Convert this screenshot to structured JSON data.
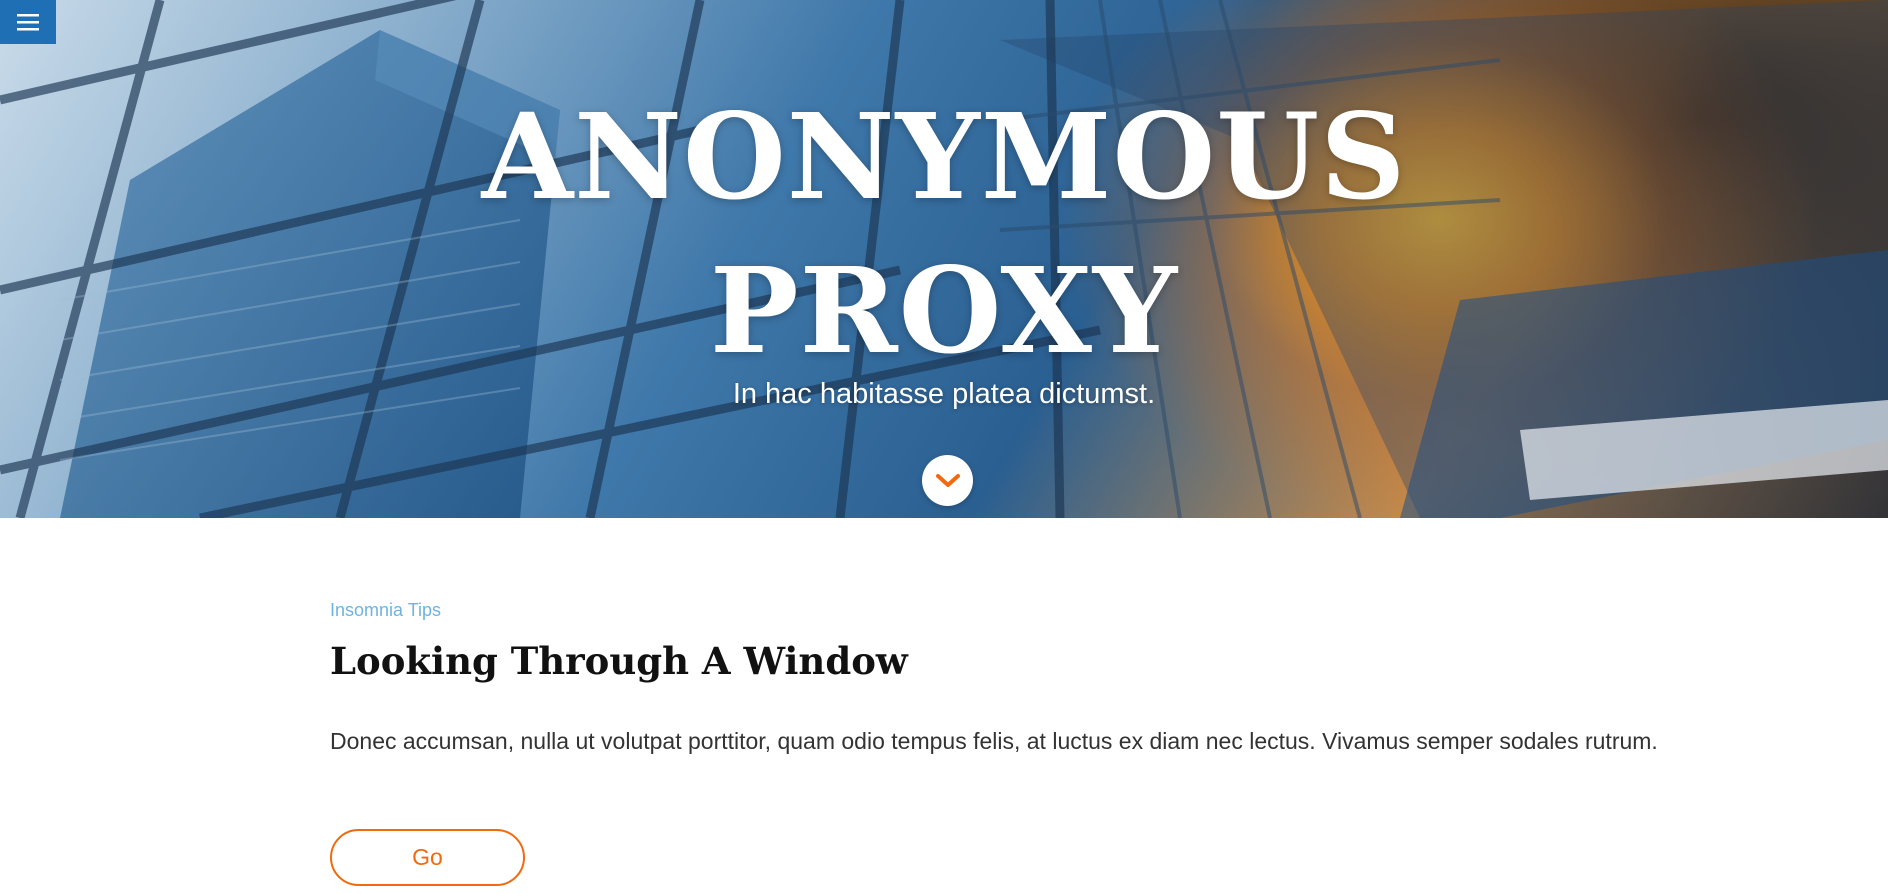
{
  "nav": {
    "menu_icon": "hamburger-menu-icon"
  },
  "hero": {
    "title_line1": "ANONYMOUS",
    "title_line2": "PROXY",
    "subtitle": "In hac habitasse platea dictumst.",
    "scroll_icon": "chevron-down-icon"
  },
  "post": {
    "category": "Insomnia Tips",
    "title": "Looking Through A Window",
    "body": "Donec accumsan, nulla ut volutpat porttitor, quam odio tempus felis, at luctus ex diam nec lectus. Vivamus semper sodales rutrum.",
    "button_label": "Go"
  },
  "colors": {
    "menu_bg": "#1f6fb5",
    "accent": "#f26a10",
    "category": "#6fb3e0"
  }
}
